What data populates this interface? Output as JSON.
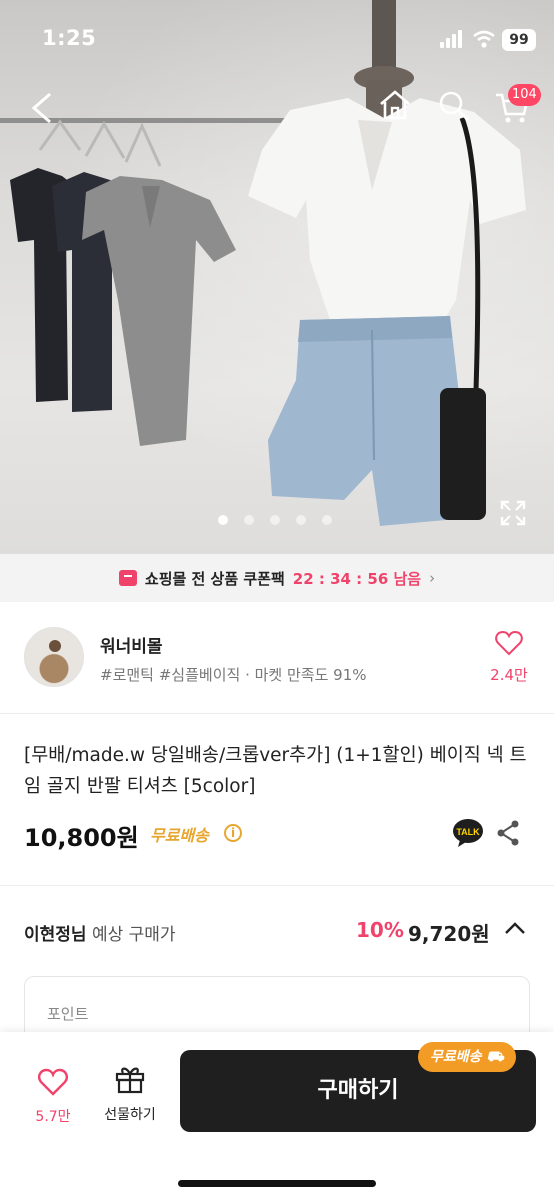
{
  "status_bar": {
    "time": "1:25",
    "battery": "99"
  },
  "header": {
    "cart_count": "104"
  },
  "gallery": {
    "dot_count": 5,
    "active_index": 0
  },
  "coupon": {
    "label": "쇼핑몰 전 상품 쿠폰팩",
    "timer": "22 : 34 : 56 남음",
    "chevron": "›"
  },
  "shop": {
    "name": "워너비몰",
    "tags": "#로맨틱 #심플베이직 · 마켓 만족도 91%",
    "likes": "2.4만"
  },
  "product": {
    "title": "[무배/made.w 당일배송/크롭ver추가] (1+1할인) 베이직 넥 트임 골지 반팔 티셔츠 [5color]",
    "price": "10,800원",
    "shipping": "무료배송",
    "info_glyph": "i"
  },
  "expected": {
    "user": "이현정님",
    "label": "예상 구매가",
    "discount": "10%",
    "price": "9,720원"
  },
  "point": {
    "label": "포인트"
  },
  "bottom_bar": {
    "likes": "5.7만",
    "gift_label": "선물하기",
    "buy_label": "구매하기",
    "badge": "무료배송"
  },
  "colors": {
    "accent": "#f0436b",
    "shipping": "#e7a62f",
    "buy": "#1f1f1f",
    "badge": "#f29b25"
  }
}
